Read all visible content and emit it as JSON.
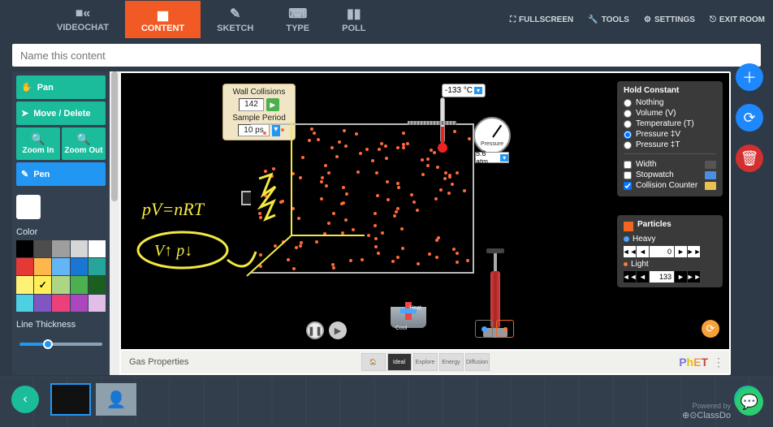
{
  "tabs": {
    "videochat": "VIDEOCHAT",
    "content": "CONTENT",
    "sketch": "SKETCH",
    "type": "TYPE",
    "poll": "POLL"
  },
  "top_menu": {
    "fullscreen": "FULLSCREEN",
    "tools": "TOOLS",
    "settings": "SETTINGS",
    "exitroom": "EXIT ROOM"
  },
  "title_placeholder": "Name this content",
  "tools": {
    "pan": "Pan",
    "movedelete": "Move / Delete",
    "zoomin": "Zoom In",
    "zoomout": "Zoom Out",
    "pen": "Pen"
  },
  "color_label": "Color",
  "thickness_label": "Line Thickness",
  "colors": [
    "#000000",
    "#4d4d4d",
    "#9e9e9e",
    "#d6d6d6",
    "#ffffff",
    "#e53935",
    "#ffb74d",
    "#64b5f6",
    "#1976d2",
    "#26a69a",
    "#fff176",
    "#ffee58",
    "#aed581",
    "#4caf50",
    "#1b5e20",
    "#4dd0e1",
    "#7e57c2",
    "#ec407a",
    "#ab47bc",
    "#e1bee7"
  ],
  "selected_color_index": 11,
  "sim": {
    "wall_collisions_label": "Wall Collisions",
    "wall_collisions_value": "142",
    "sample_period_label": "Sample Period",
    "sample_period_value": "10 ps",
    "temp_display": "-133 °C",
    "pressure_label": "Pressure",
    "pressure_value": "5.6 atm",
    "hold_constant": {
      "title": "Hold Constant",
      "nothing": "Nothing",
      "volume": "Volume (V)",
      "temperature": "Temperature (T)",
      "pressurev": "Pressure ‡V",
      "pressuret": "Pressure ‡T",
      "width": "Width",
      "stopwatch": "Stopwatch",
      "collision_counter": "Collision Counter"
    },
    "particles": {
      "title": "Particles",
      "heavy": "Heavy",
      "heavy_value": "0",
      "light": "Light",
      "light_value": "133"
    },
    "heat_label": "Heat",
    "cool_label": "Cool",
    "footer_title": "Gas Properties",
    "modes": {
      "ideal": "Ideal",
      "explore": "Explore",
      "energy": "Energy",
      "diffusion": "Diffusion"
    },
    "annotations": {
      "eq1": "pV=nRT",
      "eq2": "V↑ p↓"
    }
  },
  "powered_by": "Powered by",
  "brand": "⊕⊙ClassDo"
}
